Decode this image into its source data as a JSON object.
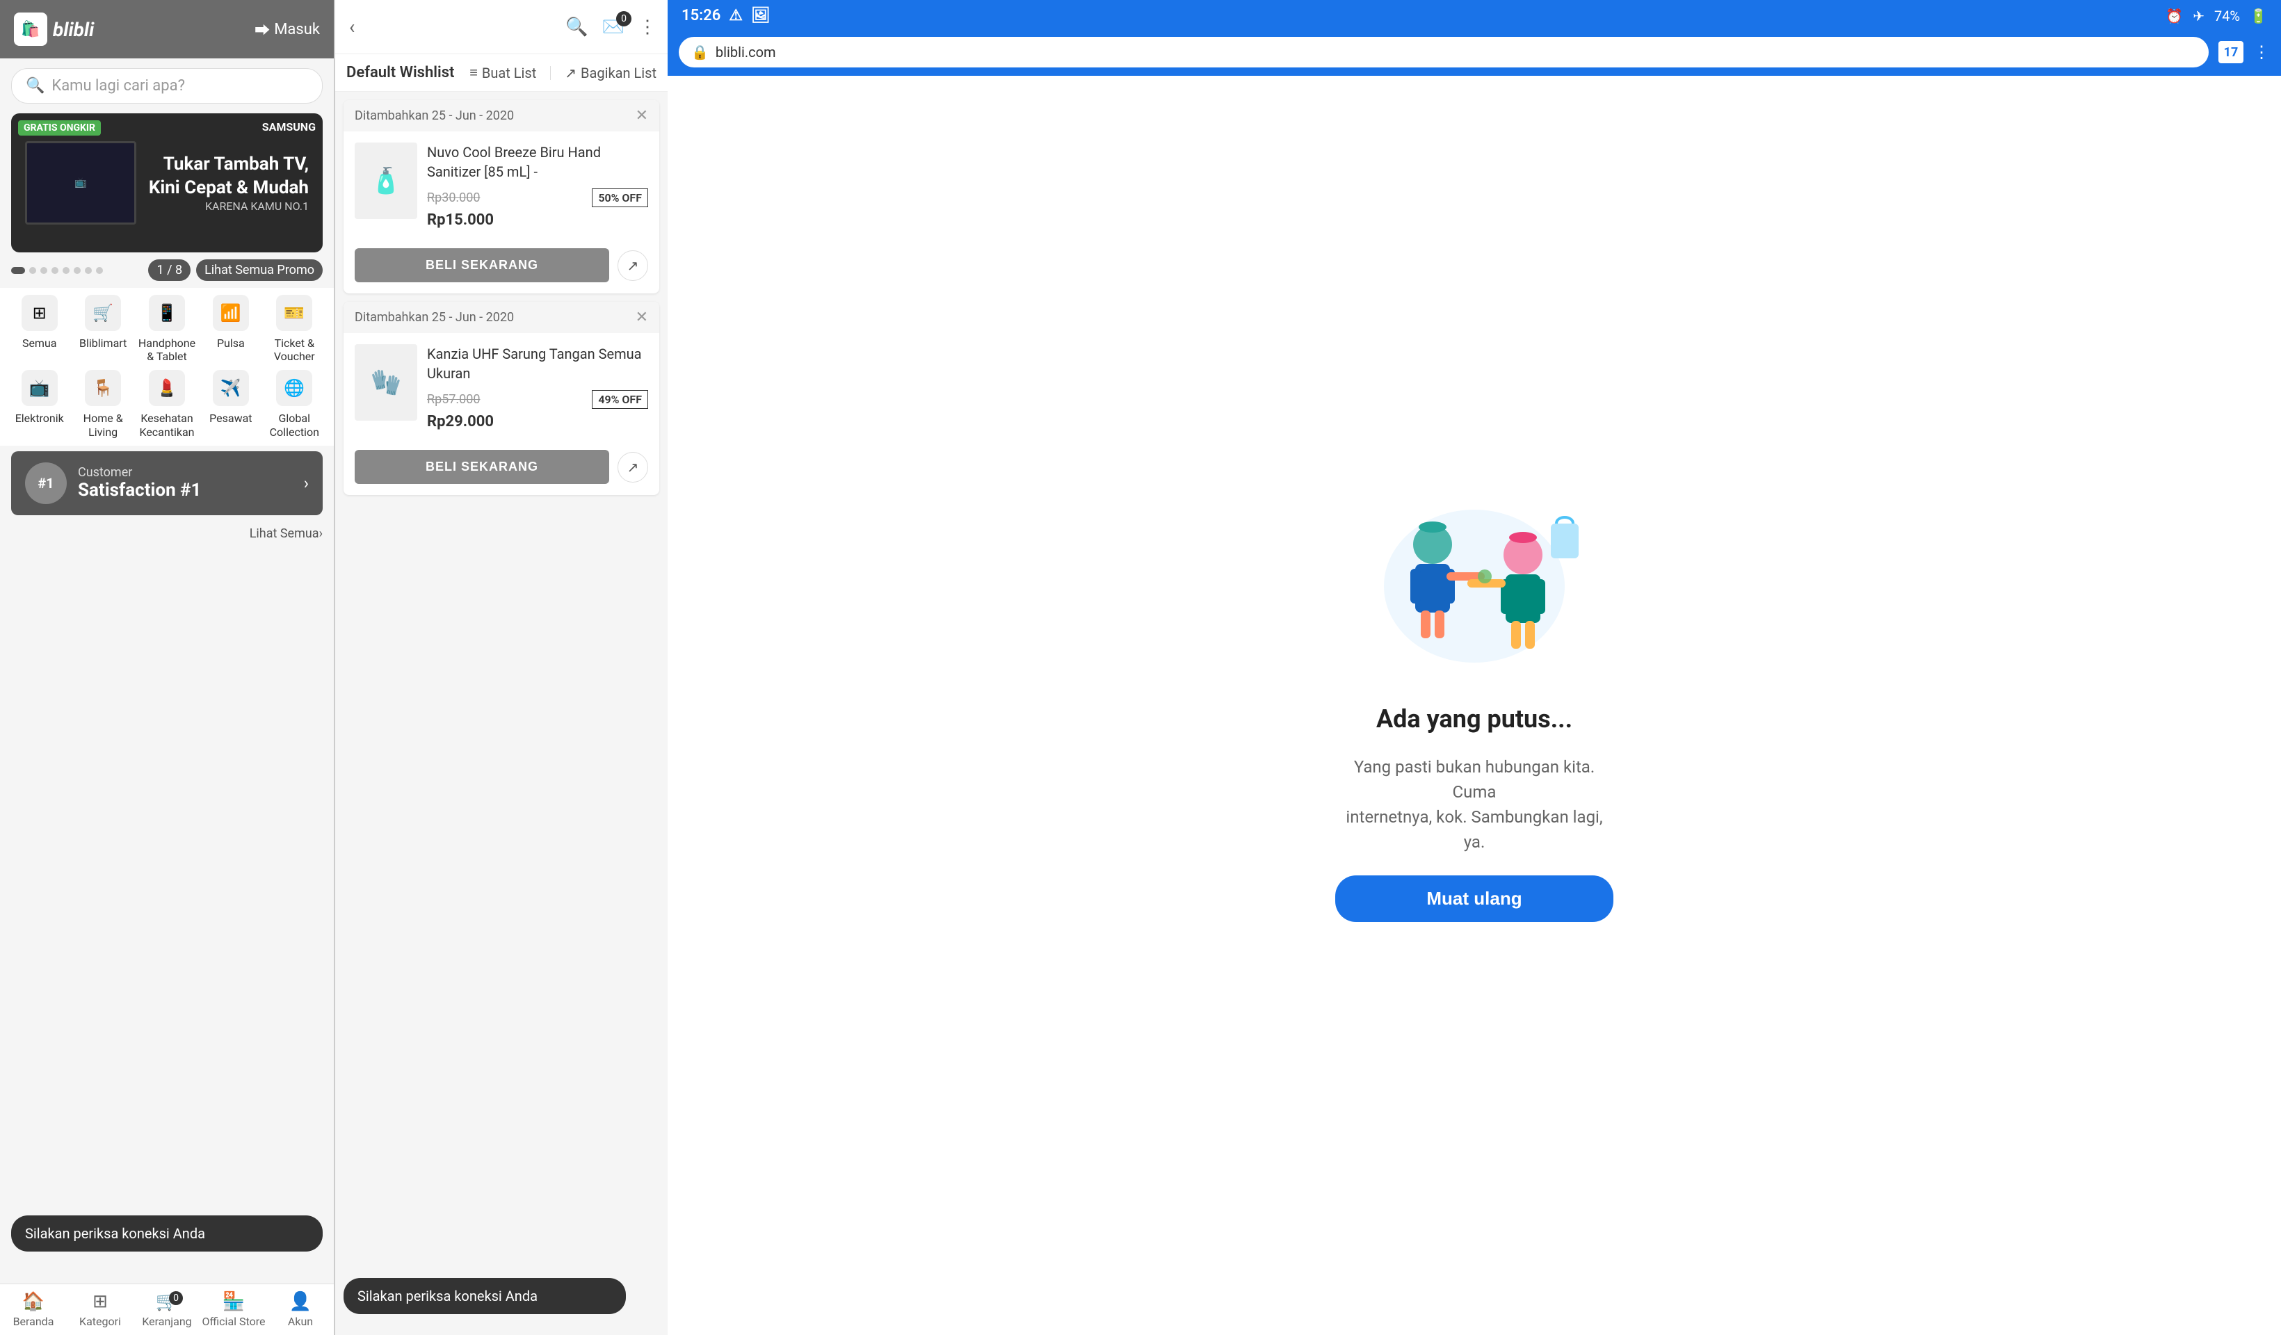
{
  "panel1": {
    "header": {
      "logo_text": "blibli",
      "login_label": "Masuk"
    },
    "search": {
      "placeholder": "Kamu lagi cari apa?"
    },
    "banner": {
      "tag": "GRATIS ONGKIR",
      "brand": "SAMSUNG",
      "title": "Tukar Tambah TV,\nKini Cepat & Mudah",
      "subtitle": "KARENA KAMU NO.1",
      "page": "1 / 8",
      "promo_btn": "Lihat Semua Promo"
    },
    "categories": [
      {
        "id": "semua",
        "icon": "⊞",
        "label": "Semua"
      },
      {
        "id": "bliblimart",
        "icon": "🛒",
        "label": "Bliblimart"
      },
      {
        "id": "handphone",
        "icon": "📱",
        "label": "Handphone & Tablet"
      },
      {
        "id": "pulsa",
        "icon": "📶",
        "label": "Pulsa"
      },
      {
        "id": "ticket",
        "icon": "🎫",
        "label": "Ticket & Voucher"
      },
      {
        "id": "elektronik",
        "icon": "📺",
        "label": "Elektronik"
      },
      {
        "id": "homeliving",
        "icon": "🪑",
        "label": "Home & Living"
      },
      {
        "id": "kesehatan",
        "icon": "💄",
        "label": "Kesehatan Kecantikan"
      },
      {
        "id": "pesawat",
        "icon": "✈️",
        "label": "Pesawat"
      },
      {
        "id": "global",
        "icon": "🌐",
        "label": "Global Collection"
      }
    ],
    "satisfaction": {
      "badge": "#1",
      "label": "Customer",
      "title": "Satisfaction #1"
    },
    "toast": "Silakan periksa koneksi Anda",
    "lihat_semua": "Lihat Semua",
    "nav": [
      {
        "id": "beranda",
        "icon": "🏠",
        "label": "Beranda",
        "active": true
      },
      {
        "id": "kategori",
        "icon": "⊞",
        "label": "Kategori",
        "active": false
      },
      {
        "id": "keranjang",
        "icon": "🛒",
        "label": "Keranjang",
        "active": false,
        "badge": "0"
      },
      {
        "id": "official",
        "icon": "🏪",
        "label": "Official Store",
        "active": false
      },
      {
        "id": "akun",
        "icon": "👤",
        "label": "Akun",
        "active": false
      }
    ]
  },
  "panel2": {
    "back_icon": "‹",
    "cart_badge": "0",
    "wishlist_title": "Default Wishlist",
    "buat_list": "Buat List",
    "bagikan_list": "Bagikan List",
    "items": [
      {
        "date": "Ditambahkan 25 - Jun - 2020",
        "name": "Nuvo Cool Breeze Biru Hand Sanitizer [85 mL] -",
        "original_price": "Rp30.000",
        "sale_price": "Rp15.000",
        "discount": "50% OFF",
        "icon": "🧴",
        "beli_btn": "BELI SEKARANG"
      },
      {
        "date": "Ditambahkan 25 - Jun - 2020",
        "name": "Kanzia UHF Sarung Tangan Semua Ukuran",
        "original_price": "Rp57.000",
        "sale_price": "Rp29.000",
        "discount": "49% OFF",
        "icon": "🧤",
        "beli_btn": "BELI SEKARANG"
      }
    ],
    "toast": "Silakan periksa koneksi Anda"
  },
  "panel3": {
    "status_bar": {
      "time": "15:26",
      "battery": "74%"
    },
    "browser": {
      "url": "blibli.com",
      "tabs_count": "17"
    },
    "error": {
      "title": "Ada yang putus...",
      "subtitle": "Yang pasti bukan hubungan kita. Cuma\ninternetnya, kok. Sambungkan lagi, ya.",
      "reload_btn": "Muat ulang"
    }
  }
}
